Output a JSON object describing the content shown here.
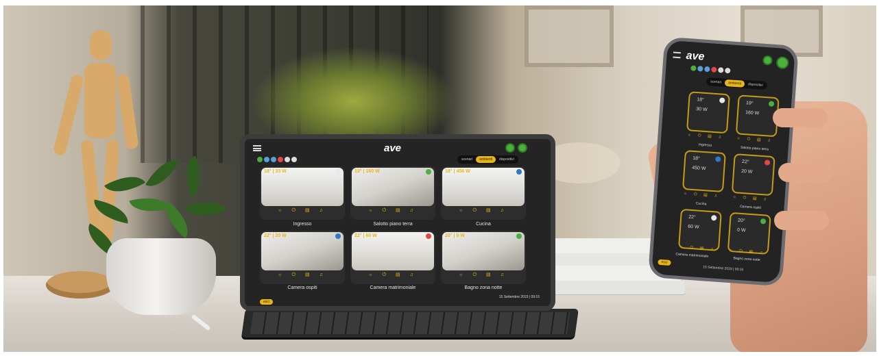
{
  "tablet": {
    "logo": "ave",
    "tabs": [
      "scenari",
      "ambienti",
      "dispositivi"
    ],
    "active_tab": "ambienti",
    "rooms": [
      {
        "name": "Ingresso",
        "temp": "18°",
        "power": "33 W",
        "icons": "☼ ⏻ ▤ ♫",
        "lock_color": "#e9e9e9"
      },
      {
        "name": "Salotto piano terra",
        "temp": "19°",
        "power": "160 W",
        "icons": "☼ ⏻ ▤ ♫",
        "lock_color": "#4caf3e"
      },
      {
        "name": "Cucina",
        "temp": "18°",
        "power": "456 W",
        "icons": "☼ ⏻ ▤ ♫",
        "lock_color": "#2f79c8"
      },
      {
        "name": "Camera ospiti",
        "temp": "22°",
        "power": "20 W",
        "icons": "☼ ⏻ ▤ ♫",
        "lock_color": "#2f79c8"
      },
      {
        "name": "Camera matrimoniale",
        "temp": "22°",
        "power": "60 W",
        "icons": "☼ ⏻ ▤ ♫",
        "lock_color": "#e04848"
      },
      {
        "name": "Bagno zona notte",
        "temp": "20°",
        "power": "0 W",
        "icons": "☼ ⏻ ▤ ♫",
        "lock_color": "#4caf3e"
      }
    ],
    "exit_label": "esci",
    "datetime": "15 Settembre 2023 | 09:15"
  },
  "phone": {
    "logo": "ave",
    "tabs": [
      "scenari",
      "ambienti",
      "dispositivi"
    ],
    "active_tab": "ambienti",
    "rooms": [
      {
        "name": "Ingresso",
        "temp": "18°",
        "power": "30 W",
        "icons": "☼ ⏻ ▤ ♫",
        "lock_color": "#e9e9e9"
      },
      {
        "name": "Salotto piano terra",
        "temp": "19°",
        "power": "160 W",
        "icons": "☼ ⏻ ▤ ♫",
        "lock_color": "#4caf3e"
      },
      {
        "name": "Cucina",
        "temp": "18°",
        "power": "450 W",
        "icons": "☼ ⏻ ▤ ♫",
        "lock_color": "#2f79c8"
      },
      {
        "name": "Camera ospiti",
        "temp": "22°",
        "power": "20 W",
        "icons": "☼ ⏻ ▤ ♫",
        "lock_color": "#e04848"
      },
      {
        "name": "Camera matrimoniale",
        "temp": "22°",
        "power": "60 W",
        "icons": "☼ ⏻ ▤ ♫",
        "lock_color": "#e9e9e9"
      },
      {
        "name": "Bagno zona notte",
        "temp": "20°",
        "power": "0 W",
        "icons": "☼ ⏻ ▤ ♫",
        "lock_color": "#4caf3e"
      }
    ],
    "exit_label": "esci",
    "datetime": "15 Settembre 2023 | 09:15"
  },
  "colors": {
    "accent": "#e8b518",
    "status_green": "#4caf3e",
    "status_blue": "#2f79c8",
    "status_red": "#e04848"
  }
}
